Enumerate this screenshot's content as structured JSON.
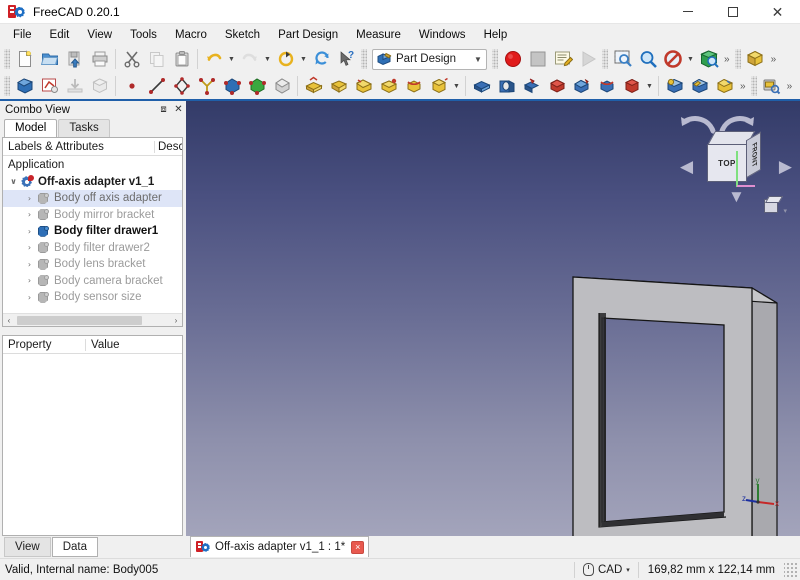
{
  "window": {
    "title": "FreeCAD 0.20.1",
    "app_icon": "freecad-logo-icon",
    "minimize_label": "Minimize",
    "maximize_label": "Maximize",
    "close_label": "Close"
  },
  "menubar": {
    "items": [
      {
        "label": "File"
      },
      {
        "label": "Edit"
      },
      {
        "label": "View"
      },
      {
        "label": "Tools"
      },
      {
        "label": "Macro"
      },
      {
        "label": "Sketch"
      },
      {
        "label": "Part Design"
      },
      {
        "label": "Measure"
      },
      {
        "label": "Windows"
      },
      {
        "label": "Help"
      }
    ]
  },
  "toolbar_row1": {
    "file_group": [
      {
        "name": "new-document-icon",
        "tip": "New"
      },
      {
        "name": "open-document-icon",
        "tip": "Open"
      },
      {
        "name": "save-document-icon",
        "tip": "Save"
      },
      {
        "name": "print-document-icon",
        "tip": "Print"
      }
    ],
    "edit_group": [
      {
        "name": "cut-icon",
        "tip": "Cut"
      },
      {
        "name": "copy-icon",
        "tip": "Copy"
      },
      {
        "name": "paste-icon",
        "tip": "Paste"
      }
    ],
    "undo_redo_group": [
      {
        "name": "undo-icon",
        "tip": "Undo"
      },
      {
        "name": "redo-icon",
        "tip": "Redo"
      },
      {
        "name": "refresh-icon",
        "tip": "Refresh"
      },
      {
        "name": "whats-this-icon",
        "tip": "What's This?"
      }
    ],
    "workbench": {
      "selected": "Part Design",
      "icon": "part-design-workbench-icon",
      "chevron": "chevron-down-icon"
    },
    "macro_group": [
      {
        "name": "macro-record-icon",
        "tip": "Macro recording"
      },
      {
        "name": "macro-stop-icon",
        "tip": "Stop macro recording"
      },
      {
        "name": "macro-edit-icon",
        "tip": "Macros"
      },
      {
        "name": "macro-execute-icon",
        "tip": "Execute macro"
      }
    ],
    "view_group": [
      {
        "name": "fit-all-icon",
        "tip": "Fits the whole content on the screen"
      },
      {
        "name": "zoom-area-icon",
        "tip": "Fit selection"
      },
      {
        "name": "draw-style-icon",
        "tip": "Draw style"
      },
      {
        "name": "axonometric-view-icon",
        "tip": "Axonometric"
      }
    ],
    "overflow": "»",
    "structure_group": [
      {
        "name": "create-part-icon",
        "tip": "Create part"
      }
    ]
  },
  "toolbar_row2": {
    "partdesign_group": [
      {
        "name": "create-body-icon",
        "tip": "Create body"
      },
      {
        "name": "create-sketch-icon",
        "tip": "Create sketch"
      },
      {
        "name": "attach-sketch-icon",
        "tip": "Attach sketch"
      },
      {
        "name": "validate-sketch-icon",
        "tip": "Validate sketch"
      }
    ],
    "sketcher_group": [
      {
        "name": "point-icon",
        "tip": "Create point"
      },
      {
        "name": "line-icon",
        "tip": "Create line"
      },
      {
        "name": "polyline-icon",
        "tip": "Create polyline"
      },
      {
        "name": "constraint-icon",
        "tip": "Create constraint"
      },
      {
        "name": "blue-shape-icon",
        "tip": "Create additive shape"
      },
      {
        "name": "green-shape-icon",
        "tip": "Create subtractive shape"
      },
      {
        "name": "boolean-icon",
        "tip": "Boolean operation"
      }
    ],
    "additive_group": [
      {
        "name": "pad-icon",
        "tip": "Pad"
      },
      {
        "name": "revolution-icon",
        "tip": "Revolution"
      },
      {
        "name": "additive-loft-icon",
        "tip": "Additive loft"
      },
      {
        "name": "additive-pipe-icon",
        "tip": "Additive pipe"
      },
      {
        "name": "additive-helix-icon",
        "tip": "Additive helix"
      },
      {
        "name": "additive-primitive-icon",
        "tip": "Create an additive primitive"
      }
    ],
    "subtractive_group": [
      {
        "name": "pocket-icon",
        "tip": "Pocket"
      },
      {
        "name": "hole-icon",
        "tip": "Hole"
      },
      {
        "name": "groove-icon",
        "tip": "Groove"
      },
      {
        "name": "subtractive-loft-icon",
        "tip": "Subtractive loft"
      },
      {
        "name": "subtractive-pipe-icon",
        "tip": "Subtractive pipe"
      },
      {
        "name": "subtractive-helix-icon",
        "tip": "Subtractive helix"
      },
      {
        "name": "subtractive-primitive-icon",
        "tip": "Create a subtractive primitive"
      }
    ],
    "dressup_group": [
      {
        "name": "fillet-icon",
        "tip": "Fillet"
      },
      {
        "name": "chamfer-icon",
        "tip": "Chamfer"
      },
      {
        "name": "draft-icon",
        "tip": "Draft"
      }
    ],
    "overflow": "»",
    "measure_group": [
      {
        "name": "measure-icon",
        "tip": "Measure"
      }
    ]
  },
  "combo_view": {
    "title": "Combo View",
    "float_icon": "float-panel-icon",
    "close_icon": "close-panel-icon",
    "tabs": [
      {
        "label": "Model",
        "active": true
      },
      {
        "label": "Tasks",
        "active": false
      }
    ],
    "tree": {
      "columns": [
        "Labels & Attributes",
        "Descr"
      ],
      "root_label": "Application",
      "document": {
        "label": "Off-axis adapter v1_1",
        "expanded": true,
        "twisty": "∨",
        "icon": "freecad-document-icon"
      },
      "items": [
        {
          "label": "Body off axis adapter",
          "icon": "body-icon",
          "state": "hidden",
          "selected": true,
          "twisty": "›"
        },
        {
          "label": "Body mirror bracket",
          "icon": "body-icon",
          "state": "hidden",
          "selected": false,
          "twisty": "›"
        },
        {
          "label": "Body filter drawer1",
          "icon": "body-icon",
          "state": "visible",
          "selected": false,
          "twisty": "›"
        },
        {
          "label": "Body filter drawer2",
          "icon": "body-icon",
          "state": "hidden",
          "selected": false,
          "twisty": "›"
        },
        {
          "label": "Body lens bracket",
          "icon": "body-icon",
          "state": "hidden",
          "selected": false,
          "twisty": "›"
        },
        {
          "label": "Body camera bracket",
          "icon": "body-icon",
          "state": "hidden",
          "selected": false,
          "twisty": "›"
        },
        {
          "label": "Body sensor size",
          "icon": "body-icon",
          "state": "hidden",
          "selected": false,
          "twisty": "›"
        }
      ],
      "hscroll_left": "‹",
      "hscroll_right": "›"
    },
    "property_editor": {
      "columns": [
        "Property",
        "Value"
      ],
      "rows": []
    },
    "bottom_tabs": [
      {
        "label": "View",
        "active": false
      },
      {
        "label": "Data",
        "active": true
      }
    ]
  },
  "viewport": {
    "nav_cube": {
      "front_face": "TOP",
      "right_face": "FRONT",
      "left_arrow": "◀",
      "right_arrow": "▶",
      "down_arrow": "▼",
      "home_icon": "home-cube-icon",
      "home_chevron": "▾"
    },
    "axis_cross": {
      "x_label": "x",
      "y_label": "y",
      "z_label": "z",
      "x_color": "#c62828",
      "y_color": "#2e7d32",
      "z_color": "#1a2ea0"
    },
    "background": {
      "gradient_top": "#333b68",
      "gradient_bottom": "#a3a4bb"
    },
    "model": {
      "name": "off-axis-adapter-frame",
      "face_color": "#b9b9b9",
      "edge_color": "#1a1a1a"
    }
  },
  "document_tabs": [
    {
      "label": "Off-axis adapter v1_1 : 1*",
      "icon": "freecad-document-icon",
      "close": "×",
      "active": true
    }
  ],
  "statusbar": {
    "message": "Valid, Internal name: Body005",
    "navigation_mode": "CAD",
    "navigation_icon": "mouse-icon",
    "navigation_chevron": "▾",
    "dimensions": "169,82 mm x 122,14 mm",
    "resize_grip": "resize-grip-icon"
  }
}
